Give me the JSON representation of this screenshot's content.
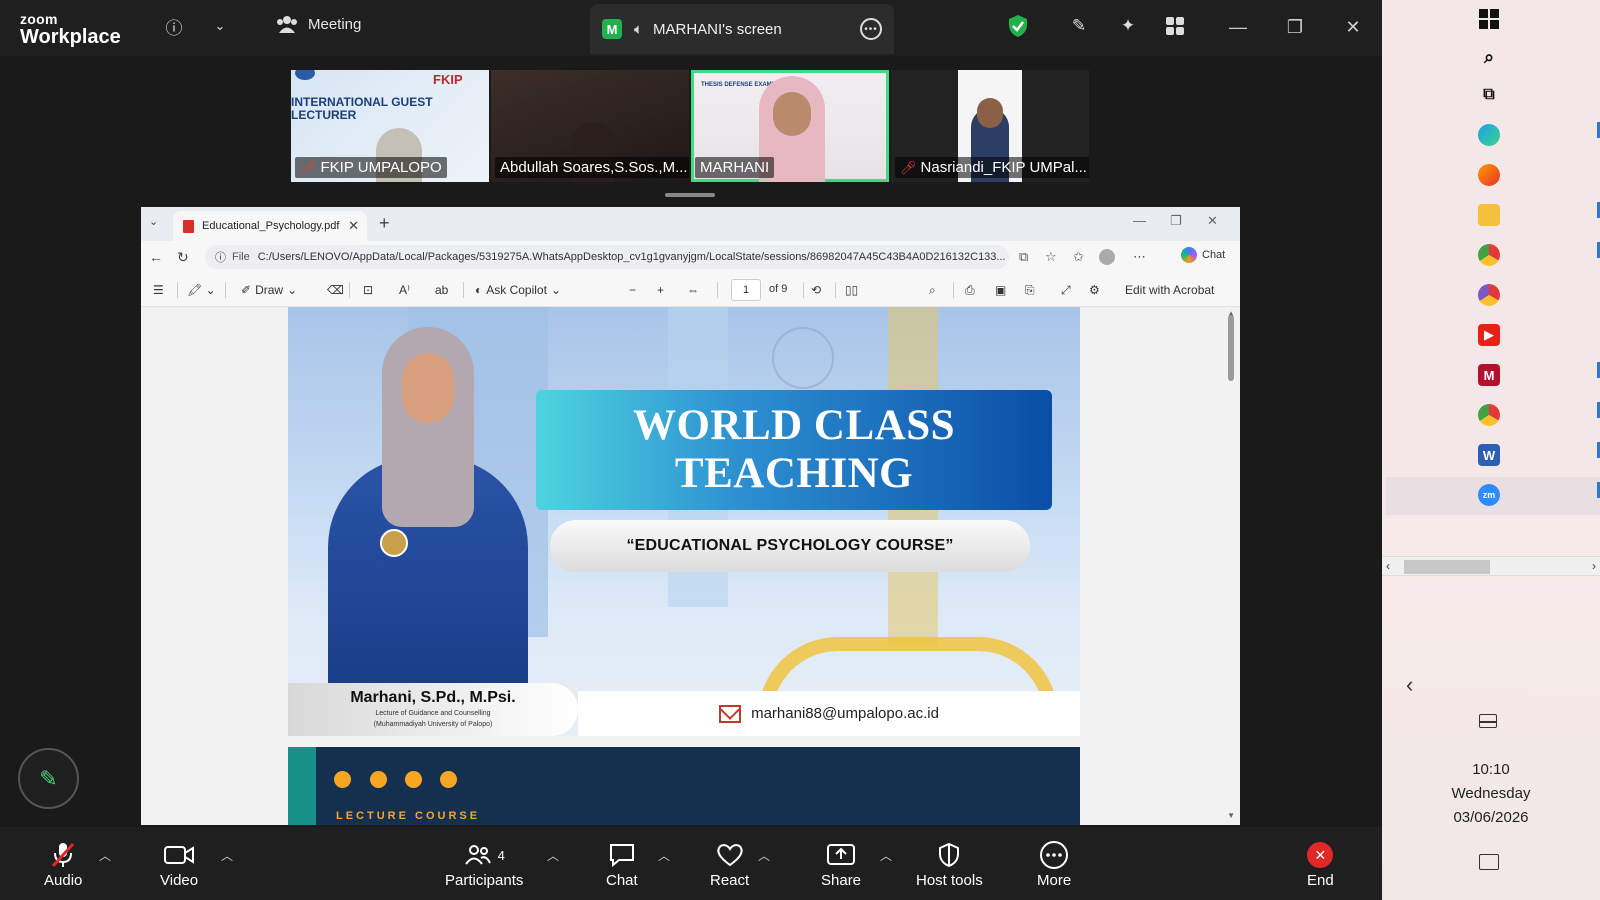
{
  "zoom": {
    "logo_line1": "zoom",
    "logo_line2": "Workplace",
    "meeting_label": "Meeting",
    "share_avatar_letter": "M",
    "share_label": "MARHANI's screen",
    "accent_green": "#22b14c"
  },
  "participants": [
    {
      "name": "FKIP UMPALOPO",
      "muted": true,
      "tile_text": "INTERNATIONAL GUEST LECTURER",
      "tile_logo_text": "FKIP"
    },
    {
      "name": "Abdullah Soares,S.Sos.,M....",
      "muted": false
    },
    {
      "name": "MARHANI",
      "muted": false,
      "active": true,
      "tile_text": "THESIS DEFENSE EXAMIN..."
    },
    {
      "name": "Nasriandi_FKIP UMPal...",
      "muted": true
    }
  ],
  "browser": {
    "tab_title": "Educational_Psychology.pdf",
    "url_scheme": "File",
    "url": "C:/Users/LENOVO/AppData/Local/Packages/5319275A.WhatsAppDesktop_cv1g1gvanyjgm/LocalState/sessions/86982047A45C43B4A0D216132C133...",
    "chat_label": "Chat"
  },
  "pdf_toolbar": {
    "draw_label": "Draw",
    "copilot_label": "Ask Copilot",
    "page_current": "1",
    "page_total": "of 9",
    "edit_label": "Edit with Acrobat"
  },
  "pdf_page1": {
    "title_line1": "WORLD CLASS",
    "title_line2": "TEACHING",
    "course": "“EDUCATIONAL PSYCHOLOGY  COURSE”",
    "presenter_name": "Marhani, S.Pd., M.Psi.",
    "presenter_role_line1": "Lecture of Guidance and Counselling",
    "presenter_role_line2": "(Muhammadiyah University of Palopo)",
    "email": "marhani88@umpalopo.ac.id"
  },
  "pdf_page2": {
    "label": "LECTURE COURSE"
  },
  "toolbar": {
    "audio": "Audio",
    "video": "Video",
    "participants": "Participants",
    "participants_count": "4",
    "chat": "Chat",
    "react": "React",
    "share": "Share",
    "host_tools": "Host tools",
    "more": "More",
    "end": "End"
  },
  "side_panel": {
    "time": "10:10",
    "day": "Wednesday",
    "date": "03/06/2026"
  }
}
